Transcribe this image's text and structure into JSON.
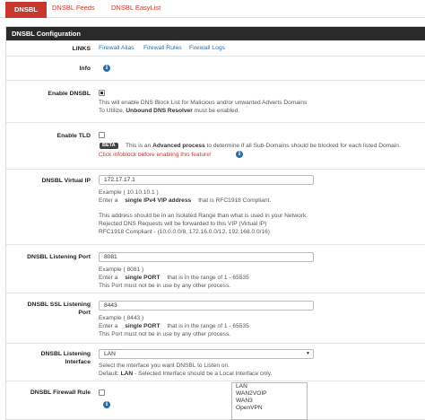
{
  "tabs": [
    {
      "label": "DNSBL",
      "active": true
    },
    {
      "label": "DNSBL Feeds",
      "active": false
    },
    {
      "label": "DNSBL EasyList",
      "active": false
    }
  ],
  "panel": {
    "title": "DNSBL Configuration"
  },
  "links": {
    "label": "LINKS",
    "items": [
      "Firewall Alias",
      "Firewall Rules",
      "Firewall Logs"
    ]
  },
  "info": {
    "label": "Info"
  },
  "enable_dnsbl": {
    "label": "Enable DNSBL",
    "checked": true,
    "help1": "This will enable DNS Block List for Malicious and/or unwanted Adverts Domains",
    "help2_pre": "To Utilize, ",
    "help2_bold": "Unbound DNS Resolver",
    "help2_post": " must be enabled."
  },
  "enable_tld": {
    "label": "Enable TLD",
    "checked": false,
    "beta": "BETA",
    "help1_pre": "This is an ",
    "help1_bold": "Advanced process",
    "help1_post": " to determine if all Sub-Domains should be blocked for each listed Domain.",
    "help2": "Click infoblock before enabling this feature!"
  },
  "virtual_ip": {
    "label": "DNSBL Virtual IP",
    "value": "172.17.17.1",
    "ex": "Example ( 10.10.10.1 )",
    "l1_pre": "Enter a",
    "l1_bold": "single IPv4 VIP address",
    "l1_post": "that is RFC1918 Compliant.",
    "l2": "This address should be in an Isolated Range than what is used in your Network.",
    "l3": "Rejected DNS Requests will be forwarded to this VIP (Virtual IP)",
    "l4": "RFC1918 Compliant - (10.0.0.0/8, 172.16.0.0/12, 192.168.0.0/16)"
  },
  "listen_port": {
    "label": "DNSBL Listening Port",
    "value": "8081",
    "ex": "Example ( 8081 )",
    "l1_pre": "Enter a",
    "l1_bold": "single PORT",
    "l1_post": "that is in the range of 1 - 65535",
    "l2": "This Port must not be in use by any other process."
  },
  "ssl_port": {
    "label1": "DNSBL SSL Listening",
    "label2": "Port",
    "value": "8443",
    "ex": "Example ( 8443 )",
    "l1_pre": "Enter a",
    "l1_bold": "single PORT",
    "l1_post": "that is in the range of 1 - 65535",
    "l2": "This Port must not be in use by any other process."
  },
  "listen_iface": {
    "label1": "DNSBL Listening",
    "label2": "Interface",
    "value": "LAN",
    "l1": "Select the interface you want DNSBL to Listen on.",
    "l2_pre": "Default: ",
    "l2_bold": "LAN",
    "l2_post": " - Selected Interface should be a Local Interface only."
  },
  "firewall_rule": {
    "label": "DNSBL Firewall Rule",
    "checked": false,
    "options": [
      "LAN",
      "WAN2VOIP",
      "WAN3",
      "OpenVPN"
    ]
  },
  "colors": {
    "accent": "#c8382f",
    "link": "#2e6da4",
    "header": "#2a2a2a"
  }
}
